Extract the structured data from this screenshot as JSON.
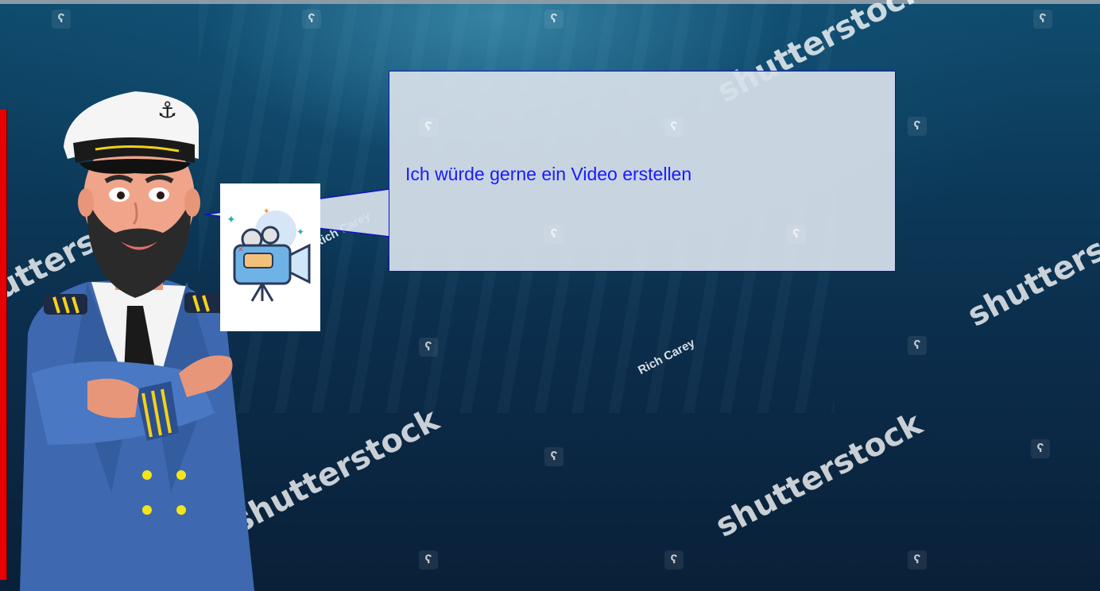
{
  "speech_bubble": {
    "text": "Ich würde gerne ein Video erstellen"
  },
  "watermarks": {
    "brand": "shutterstock",
    "author": "Rich Carey"
  },
  "illustrations": {
    "character": "ship-captain",
    "icon": "video-camera-icon"
  },
  "colors": {
    "bubble_border": "#1010d0",
    "bubble_text": "#1a1aff",
    "side_panel": "#e60000"
  }
}
